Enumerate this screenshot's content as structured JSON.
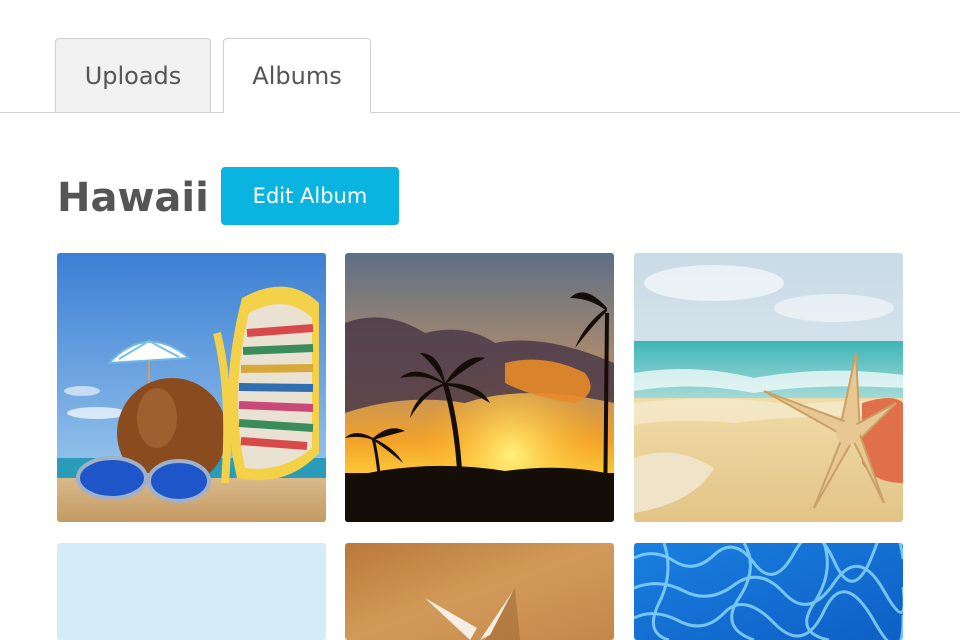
{
  "tabs": {
    "uploads_label": "Uploads",
    "albums_label": "Albums",
    "active": "Albums"
  },
  "album": {
    "title": "Hawaii",
    "edit_button_label": "Edit Album"
  },
  "colors": {
    "accent": "#0ab4e0",
    "text": "#555555",
    "tab_inactive_bg": "#f1f1f1",
    "border": "#cfcfcf"
  },
  "photos": [
    {
      "name": "beach-coconut-flip-flops-photo"
    },
    {
      "name": "palm-sunset-photo"
    },
    {
      "name": "starfish-shore-photo"
    },
    {
      "name": "light-blue-photo"
    },
    {
      "name": "sand-starfish-photo"
    },
    {
      "name": "pool-water-photo"
    }
  ]
}
